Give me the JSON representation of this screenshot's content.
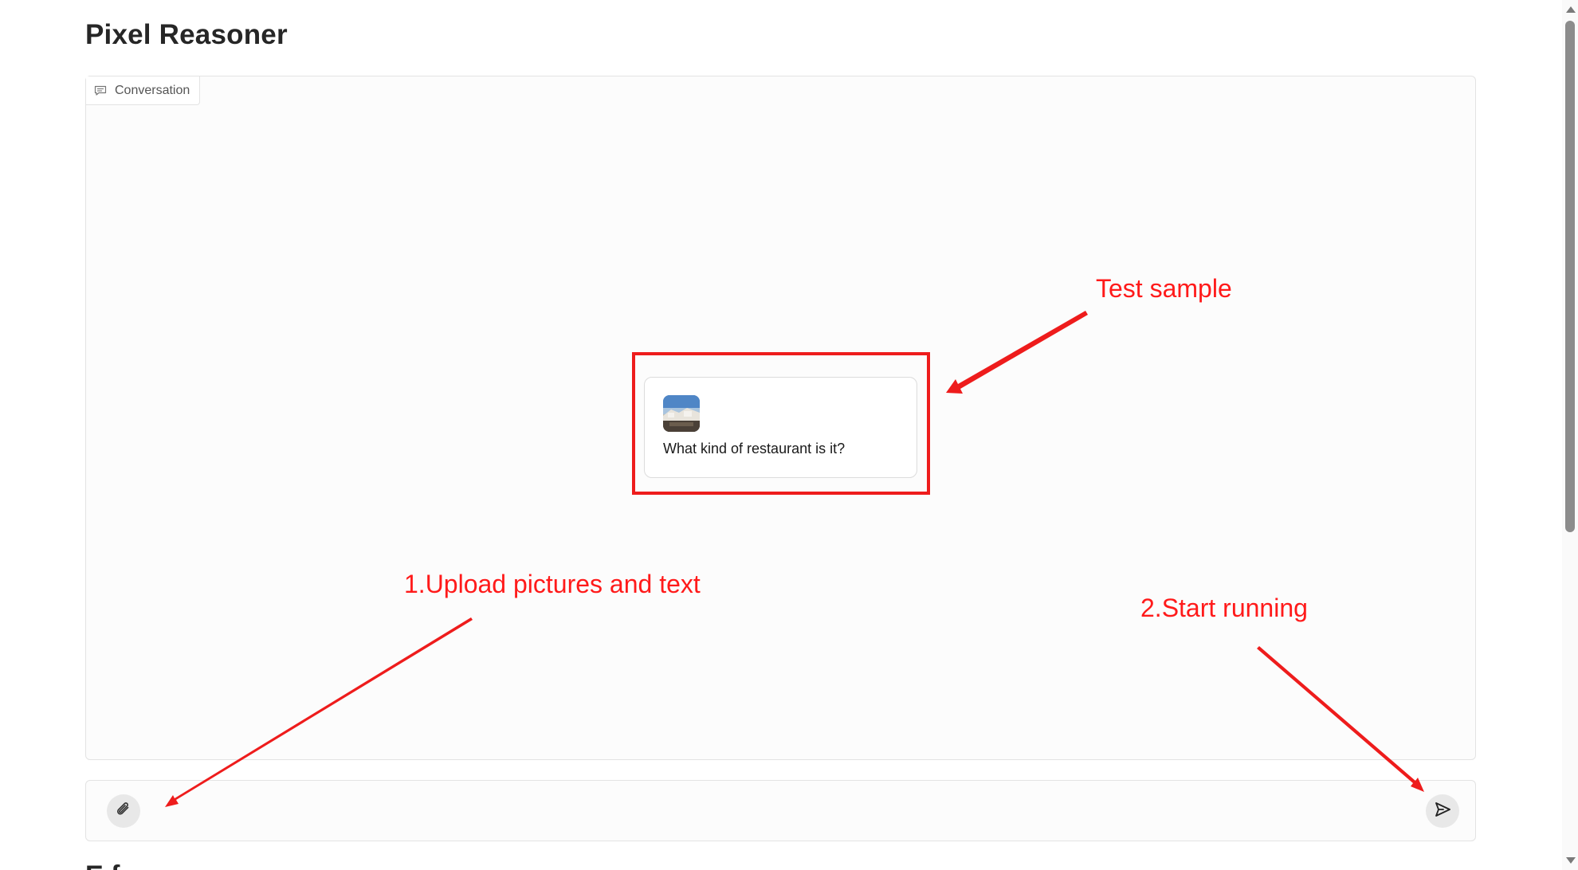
{
  "page": {
    "title": "Pixel Reasoner",
    "next_section_heading_partial": "E  f"
  },
  "chat": {
    "tab_label": "Conversation",
    "tab_icon": "chat-bubble-icon",
    "example": {
      "image_alt": "restaurant photo thumbnail",
      "text": "What kind of restaurant is it?"
    }
  },
  "input": {
    "placeholder": "",
    "value": "",
    "attach_icon": "paperclip-icon",
    "send_icon": "send-arrow-icon"
  },
  "annotations": {
    "test_sample": "Test sample",
    "upload": "1.Upload pictures and text",
    "start": "2.Start running",
    "color": "#ff1a1a"
  }
}
